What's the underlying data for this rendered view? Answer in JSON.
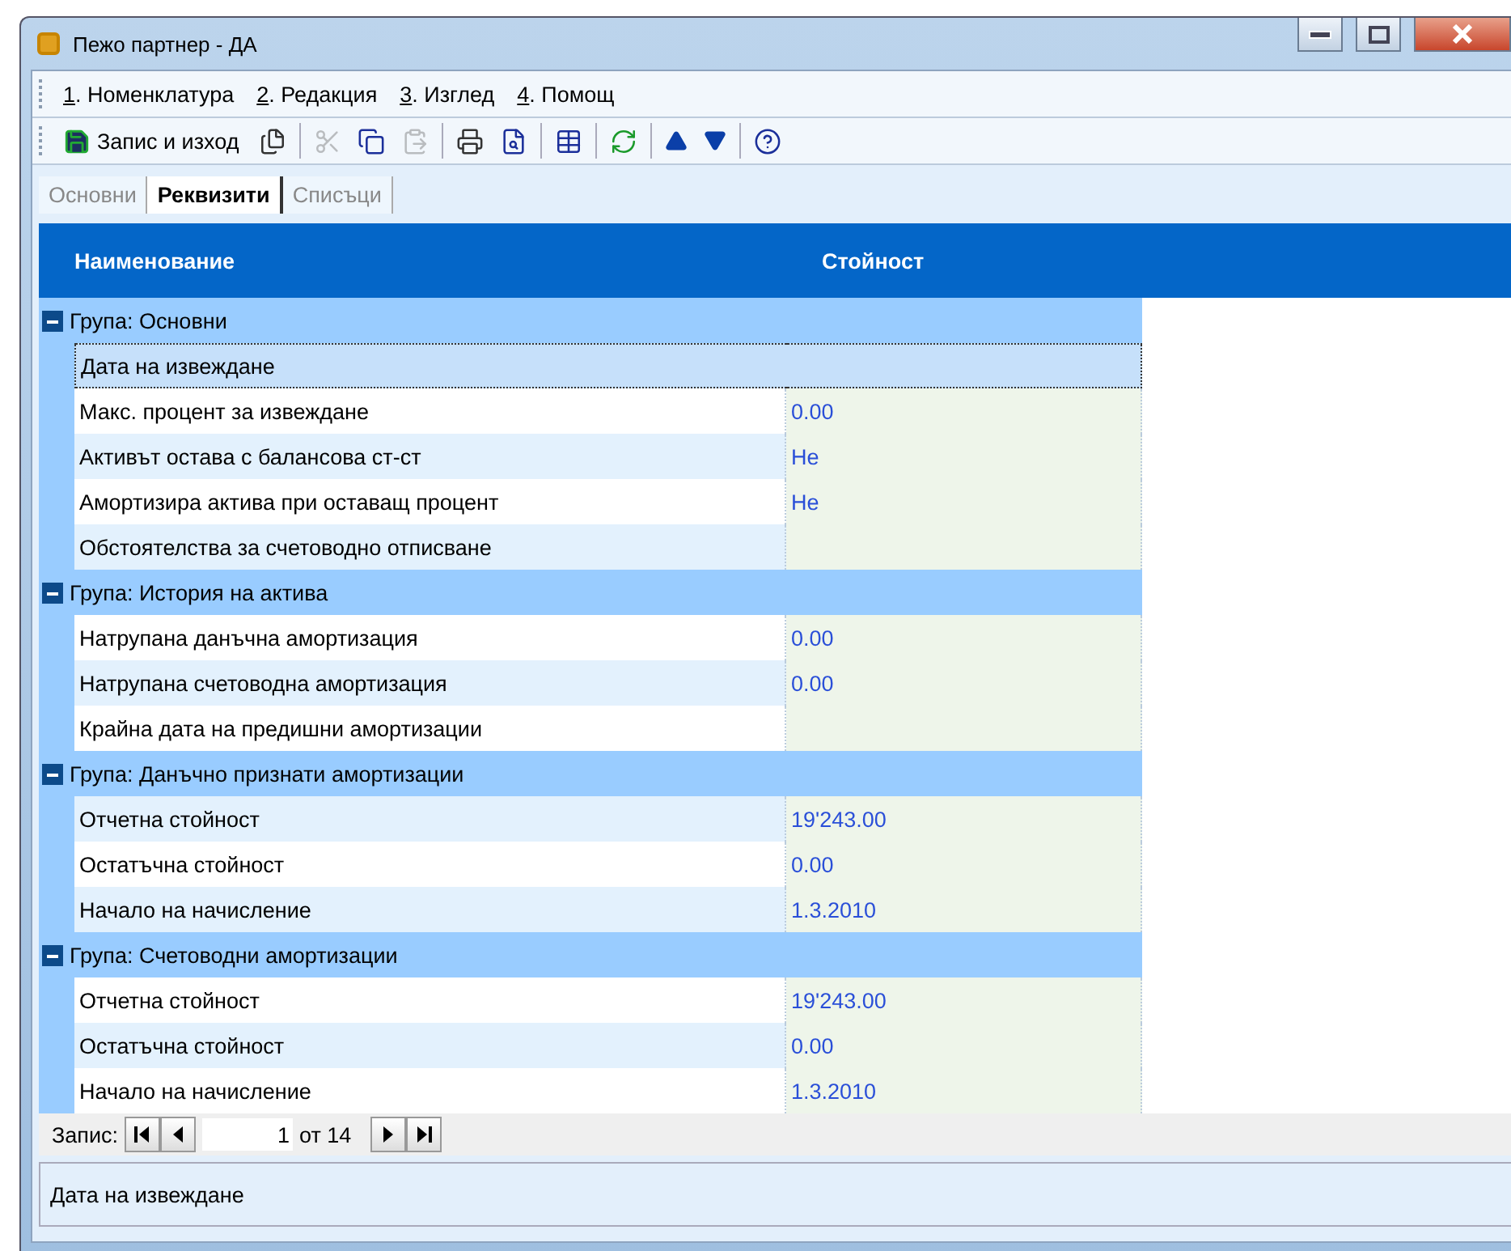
{
  "window": {
    "title": "Пежо партнер - ДА"
  },
  "menu": [
    {
      "label": "1. Номенклатура"
    },
    {
      "label": "2. Редакция"
    },
    {
      "label": "3. Изглед"
    },
    {
      "label": "4. Помощ"
    }
  ],
  "toolbar": {
    "save_label": "Запис и изход",
    "items": [
      {
        "kind": "saveas"
      },
      {
        "kind": "sep"
      },
      {
        "kind": "cut",
        "disabled": true
      },
      {
        "kind": "copy",
        "disabled": false
      },
      {
        "kind": "paste",
        "disabled": true
      },
      {
        "kind": "sep"
      },
      {
        "kind": "print",
        "disabled": false
      },
      {
        "kind": "preview",
        "disabled": false
      },
      {
        "kind": "sep"
      },
      {
        "kind": "newtable",
        "disabled": false
      },
      {
        "kind": "sep"
      },
      {
        "kind": "refresh",
        "disabled": false
      },
      {
        "kind": "sep"
      },
      {
        "kind": "up",
        "disabled": false
      },
      {
        "kind": "down",
        "disabled": false
      },
      {
        "kind": "sep"
      },
      {
        "kind": "help",
        "disabled": false
      }
    ]
  },
  "tabs": [
    {
      "label": "Основни",
      "selected": false
    },
    {
      "label": "Реквизити",
      "selected": true
    },
    {
      "label": "Списъци",
      "selected": false
    }
  ],
  "grid": {
    "columns": [
      "Наименование",
      "Стойност"
    ],
    "groups": [
      {
        "title": "Група: Основни",
        "expanded": true,
        "rows": [
          {
            "name": "Дата на извеждане",
            "value": "",
            "selected": true
          },
          {
            "name": "Макс. процент за извеждане",
            "value": "0.00",
            "selected": false
          },
          {
            "name": "Активът остава с балансова ст-ст",
            "value": "Не",
            "selected": false
          },
          {
            "name": "Амортизира актива при оставащ процент",
            "value": "Не",
            "selected": false
          },
          {
            "name": "Обстоятелства за счетоводно отписване",
            "value": "",
            "selected": false
          }
        ]
      },
      {
        "title": "Група: История на актива",
        "expanded": true,
        "rows": [
          {
            "name": "Натрупана данъчна амортизация",
            "value": "0.00",
            "selected": false
          },
          {
            "name": "Натрупана счетоводна амортизация",
            "value": "0.00",
            "selected": false
          },
          {
            "name": "Крайна дата на предишни амортизации",
            "value": "",
            "selected": false
          }
        ]
      },
      {
        "title": "Група: Данъчно признати амортизации",
        "expanded": true,
        "rows": [
          {
            "name": "Отчетна стойност",
            "value": "19'243.00",
            "selected": false
          },
          {
            "name": "Остатъчна стойност",
            "value": "0.00",
            "selected": false
          },
          {
            "name": "Начало на начисление",
            "value": "1.3.2010",
            "selected": false
          }
        ]
      },
      {
        "title": "Група: Счетоводни амортизации",
        "expanded": true,
        "rows": [
          {
            "name": "Отчетна стойност",
            "value": "19'243.00",
            "selected": false
          },
          {
            "name": "Остатъчна стойност",
            "value": "0.00",
            "selected": false
          },
          {
            "name": "Начало на начисление",
            "value": "1.3.2010",
            "selected": false
          }
        ]
      }
    ]
  },
  "navigator": {
    "label": "Запис:",
    "value": "1",
    "total": "от 14"
  },
  "status": {
    "text": "Дата на извеждане"
  }
}
